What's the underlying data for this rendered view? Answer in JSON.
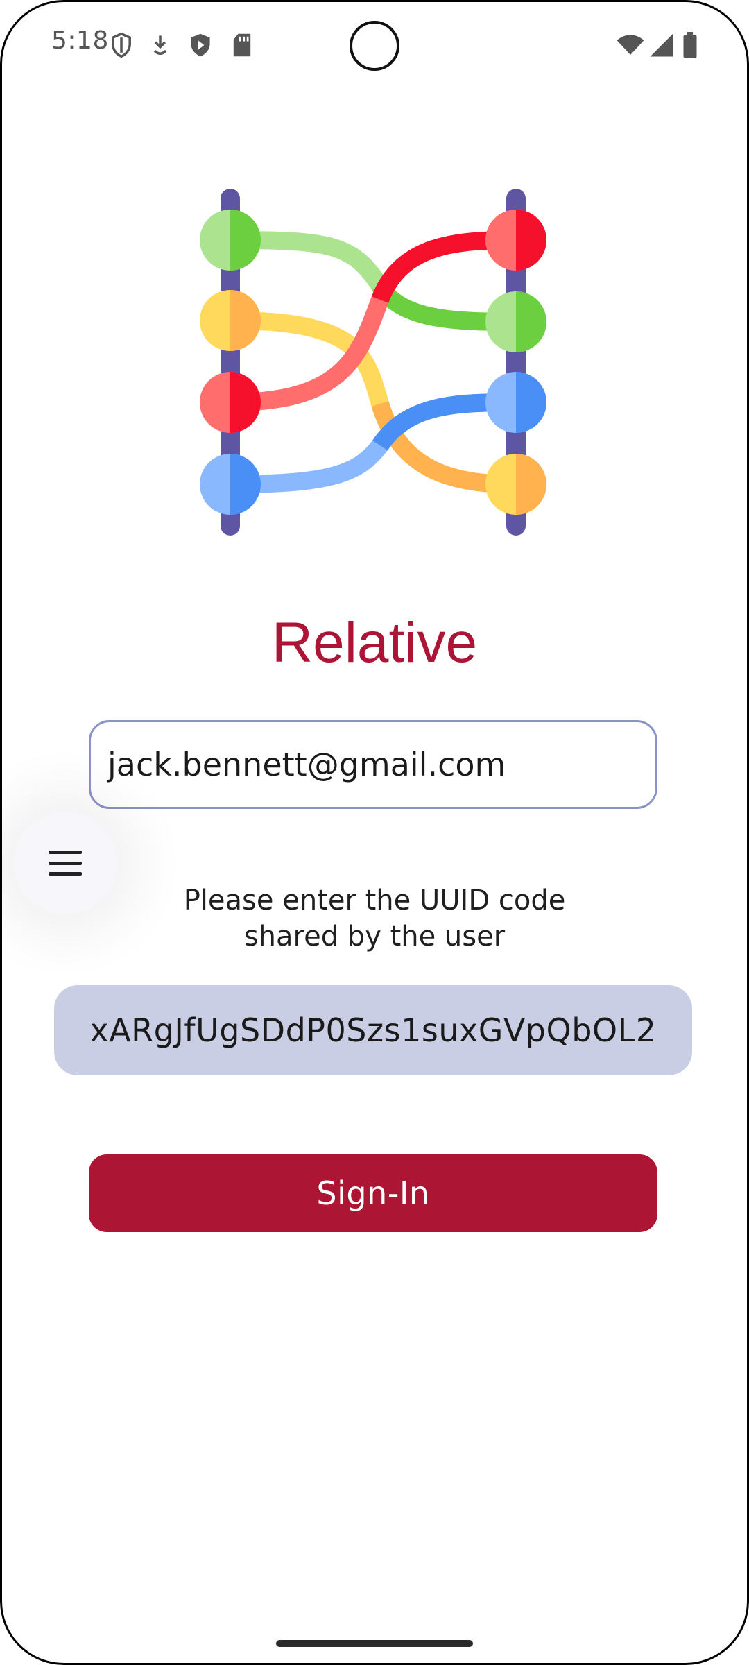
{
  "status_bar": {
    "time": "5:18",
    "icons": [
      "shield-outline-icon",
      "download-arrow-icon",
      "shield-play-icon",
      "sd-card-icon",
      "wifi-icon",
      "cell-signal-icon",
      "battery-icon"
    ]
  },
  "app": {
    "title": "Relative",
    "logo_icon": "connection-graph-logo"
  },
  "form": {
    "email_value": "jack.bennett@gmail.com",
    "uuid_prompt_line1": "Please enter the UUID code",
    "uuid_prompt_line2": "shared by the user",
    "uuid_value": "xARgJfUgSDdP0Szs1suxGVpQbOL2",
    "signin_label": "Sign-In"
  },
  "fab": {
    "icon": "hamburger-menu-icon"
  },
  "colors": {
    "brand": "#ad1536",
    "field_outline": "#8a93c7",
    "uuid_field_bg": "#cacee4",
    "button_bg": "#ad1535"
  }
}
